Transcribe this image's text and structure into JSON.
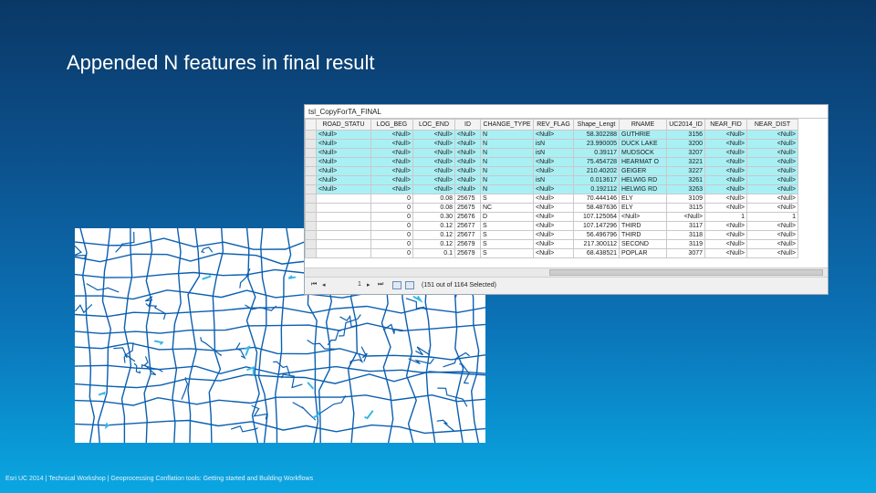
{
  "slide": {
    "title": "Appended N features in final result",
    "footer": "Esri UC 2014 | Technical Workshop | Geoprocessing Conflation tools: Getting started and Building Workflows"
  },
  "table": {
    "window_title": "tsl_CopyForTA_FINAL",
    "columns": [
      "ROAD_STATU",
      "LOG_BEG",
      "LOC_END",
      "ID",
      "CHANGE_TYPE",
      "REV_FLAG",
      "Shape_Lengt",
      "RNAME",
      "UC2014_ID",
      "NEAR_FID",
      "NEAR_DIST"
    ],
    "rows": [
      {
        "selected": true,
        "cells": [
          "<Null>",
          "<Null>",
          "<Null>",
          "<Null>",
          "N",
          "<Null>",
          "58.302288",
          "GUTHRIE",
          "3156",
          "<Null>",
          "<Null>"
        ]
      },
      {
        "selected": true,
        "cells": [
          "<Null>",
          "<Null>",
          "<Null>",
          "<Null>",
          "N",
          "isN",
          "23.990005",
          "DUCK LAKE",
          "3200",
          "<Null>",
          "<Null>"
        ]
      },
      {
        "selected": true,
        "cells": [
          "<Null>",
          "<Null>",
          "<Null>",
          "<Null>",
          "N",
          "isN",
          "0.39117",
          "MUDSOCK",
          "3207",
          "<Null>",
          "<Null>"
        ]
      },
      {
        "selected": true,
        "cells": [
          "<Null>",
          "<Null>",
          "<Null>",
          "<Null>",
          "N",
          "<Null>",
          "75.454728",
          "HEARMAT O",
          "3221",
          "<Null>",
          "<Null>"
        ]
      },
      {
        "selected": true,
        "cells": [
          "<Null>",
          "<Null>",
          "<Null>",
          "<Null>",
          "N",
          "<Null>",
          "210.40202",
          "GEIGER",
          "3227",
          "<Null>",
          "<Null>"
        ]
      },
      {
        "selected": true,
        "cells": [
          "<Null>",
          "<Null>",
          "<Null>",
          "<Null>",
          "N",
          "isN",
          "0.013617",
          "HELWIG RD",
          "3261",
          "<Null>",
          "<Null>"
        ]
      },
      {
        "selected": true,
        "cells": [
          "<Null>",
          "<Null>",
          "<Null>",
          "<Null>",
          "N",
          "<Null>",
          "0.192112",
          "HELWIG RD",
          "3263",
          "<Null>",
          "<Null>"
        ]
      },
      {
        "selected": false,
        "cells": [
          "",
          "0",
          "0.08",
          "25675",
          "S",
          "<Null>",
          "70.444146",
          "ELY",
          "3109",
          "<Null>",
          "<Null>"
        ]
      },
      {
        "selected": false,
        "cells": [
          "",
          "0",
          "0.08",
          "25675",
          "NC",
          "<Null>",
          "58.487636",
          "ELY",
          "3115",
          "<Null>",
          "<Null>"
        ]
      },
      {
        "selected": false,
        "cells": [
          "",
          "0",
          "0.30",
          "25676",
          "D",
          "<Null>",
          "107.125064",
          "<Null>",
          "<Null>",
          "1",
          "1"
        ]
      },
      {
        "selected": false,
        "cells": [
          "",
          "0",
          "0.12",
          "25677",
          "S",
          "<Null>",
          "107.147296",
          "THIRD",
          "3117",
          "<Null>",
          "<Null>"
        ]
      },
      {
        "selected": false,
        "cells": [
          "",
          "0",
          "0.12",
          "25677",
          "S",
          "<Null>",
          "56.496796",
          "THIRD",
          "3118",
          "<Null>",
          "<Null>"
        ]
      },
      {
        "selected": false,
        "cells": [
          "",
          "0",
          "0.12",
          "25679",
          "S",
          "<Null>",
          "217.300112",
          "SECOND",
          "3119",
          "<Null>",
          "<Null>"
        ]
      },
      {
        "selected": false,
        "cells": [
          "",
          "0",
          "0.1",
          "25679",
          "S",
          "<Null>",
          "68.438521",
          "POPLAR",
          "3077",
          "<Null>",
          "<Null>"
        ]
      }
    ],
    "navigation": {
      "record_value": "1",
      "status": "(151 out of 1164 Selected)"
    }
  },
  "colors": {
    "selected_row": "#a9f0f5",
    "road_line": "#0b5fb0",
    "appended_road": "#36b9e8"
  }
}
